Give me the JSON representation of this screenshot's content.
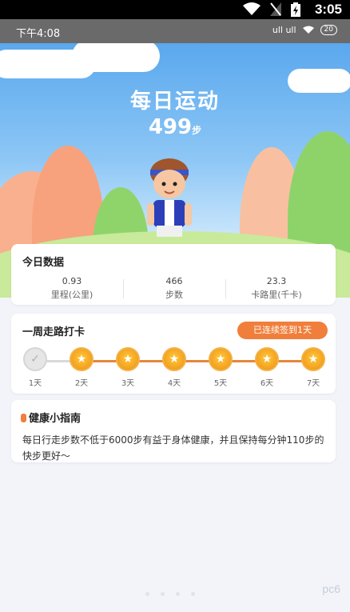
{
  "os_bar": {
    "time": "3:05"
  },
  "status_bar": {
    "time": "下午4:08",
    "signal_text": "ull ull",
    "battery": "20"
  },
  "hero": {
    "title": "每日运动",
    "steps": "499",
    "steps_unit": "步"
  },
  "today": {
    "title": "今日数据",
    "stats": [
      {
        "value": "0.93",
        "label": "里程(公里)"
      },
      {
        "value": "466",
        "label": "步数"
      },
      {
        "value": "23.3",
        "label": "卡路里(千卡)"
      }
    ]
  },
  "weekly": {
    "title": "一周走路打卡",
    "badge": "已连续签到1天",
    "days": [
      {
        "label": "1天",
        "state": "checked"
      },
      {
        "label": "2天",
        "state": "star"
      },
      {
        "label": "3天",
        "state": "star"
      },
      {
        "label": "4天",
        "state": "star"
      },
      {
        "label": "5天",
        "state": "star"
      },
      {
        "label": "6天",
        "state": "star"
      },
      {
        "label": "7天",
        "state": "star"
      }
    ]
  },
  "guide": {
    "title": "健康小指南",
    "text": "每日行走步数不低于6000步有益于身体健康，并且保持每分钟110步的快步更好～"
  },
  "watermark": "pc6"
}
